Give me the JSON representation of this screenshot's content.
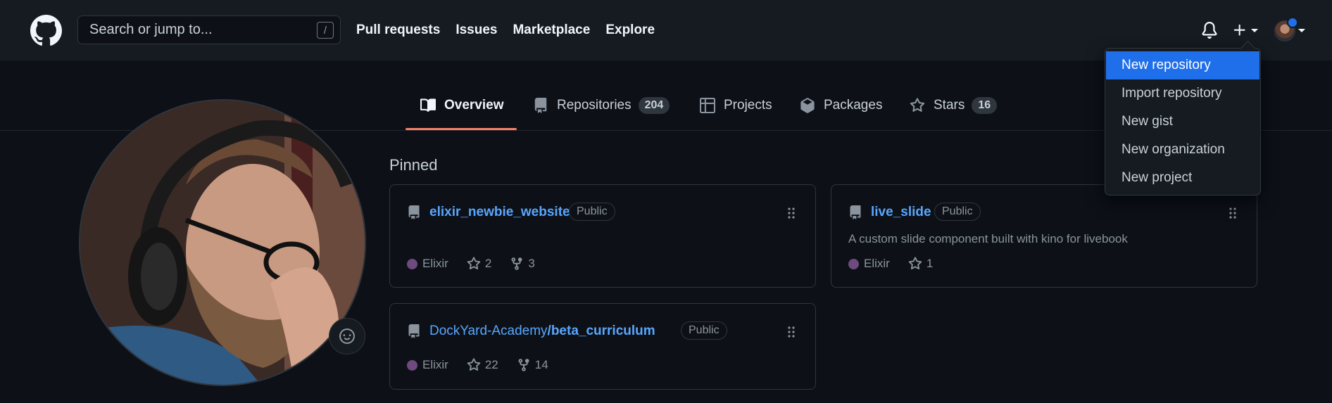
{
  "header": {
    "search_placeholder": "Search or jump to...",
    "search_shortcut": "/",
    "nav": [
      "Pull requests",
      "Issues",
      "Marketplace",
      "Explore"
    ],
    "icons": [
      "github-logo-icon",
      "bell-icon",
      "plus-icon",
      "caret-down-icon"
    ]
  },
  "tabs": [
    {
      "label": "Overview",
      "icon": "book-icon",
      "active": true
    },
    {
      "label": "Repositories",
      "icon": "repo-icon",
      "count": "204"
    },
    {
      "label": "Projects",
      "icon": "table-icon"
    },
    {
      "label": "Packages",
      "icon": "package-icon"
    },
    {
      "label": "Stars",
      "icon": "star-icon",
      "count": "16"
    }
  ],
  "pinned": {
    "title": "Pinned",
    "repos": [
      {
        "owner": "",
        "name": "elixir_newbie_website",
        "visibility": "Public",
        "description": "",
        "language": "Elixir",
        "language_color": "#6e4a7e",
        "stars": "2",
        "forks": "3"
      },
      {
        "owner": "",
        "name": "live_slide",
        "visibility": "Public",
        "description": "A custom slide component built with kino for livebook",
        "language": "Elixir",
        "language_color": "#6e4a7e",
        "stars": "1",
        "forks": ""
      },
      {
        "owner": "DockYard-Academy",
        "name": "/beta_curriculum",
        "visibility": "Public",
        "description": "",
        "language": "Elixir",
        "language_color": "#6e4a7e",
        "stars": "22",
        "forks": "14"
      }
    ]
  },
  "dropdown": {
    "items": [
      "New repository",
      "Import repository",
      "New gist",
      "New organization",
      "New project"
    ],
    "active_index": 0
  },
  "colors": {
    "accent": "#58a6ff",
    "active_tab_underline": "#f78166",
    "menu_highlight": "#1f6feb",
    "background": "#0d1117",
    "header_bg": "#161b22"
  }
}
